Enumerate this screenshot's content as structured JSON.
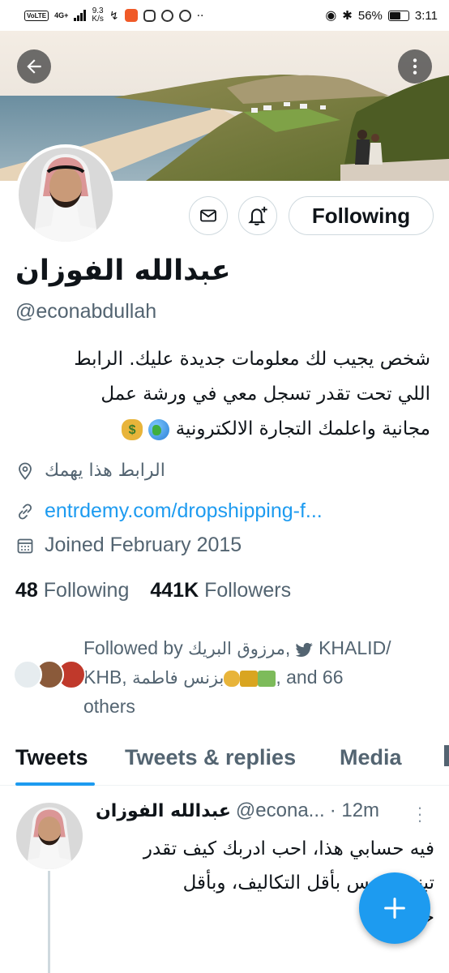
{
  "status_bar": {
    "network_badge": "VoLTE",
    "signal_label": "4G+",
    "speed": "9.3",
    "speed_unit": "K/s",
    "battery": "56%",
    "time": "3:11"
  },
  "profile": {
    "name": "عبدالله الفوزان",
    "handle": "@econabdullah",
    "bio_lines": [
      "شخص يجيب لك معلومات جديدة عليك.  الرابط",
      "اللي تحت تقدر تسجل معي في ورشة عمل",
      "مجانية واعلمك التجارة الالكترونية"
    ],
    "location": "الرابط هذا يهمك",
    "link": "entrdemy.com/dropshipping-f...",
    "joined": "Joined February 2015",
    "following_count": "48",
    "following_label": "Following",
    "followers_count": "441K",
    "followers_label": "Followers",
    "follow_button_label": "Following"
  },
  "followed_by": {
    "prefix": "Followed by",
    "name1": "مرزوق البريك",
    "name2": "KHALID/",
    "name3": "KHB",
    "name4": "بزنس فاطمة",
    "suffix": ", and 66",
    "others": "others"
  },
  "tabs": [
    {
      "label": "Tweets"
    },
    {
      "label": "Tweets & replies"
    },
    {
      "label": "Media"
    }
  ],
  "tweet": {
    "author": "عبدالله الفوزان",
    "handle": "@econa...",
    "time": "· 12m",
    "body_lines": [
      "فيه حسابي هذا، احب ادربك كيف تقدر",
      "تبني بزنيس بأقل التكاليف، وبأقل",
      "خبرة."
    ]
  },
  "icons": {
    "back": "arrow-left-icon",
    "more": "more-vertical-icon",
    "message": "envelope-icon",
    "notify": "bell-plus-icon",
    "location": "location-pin-icon",
    "link": "link-icon",
    "calendar": "calendar-icon",
    "compose": "plus-icon"
  },
  "colors": {
    "accent": "#1d9bf0",
    "text_primary": "#0f1419",
    "text_secondary": "#536471",
    "border": "#cfd9de"
  }
}
